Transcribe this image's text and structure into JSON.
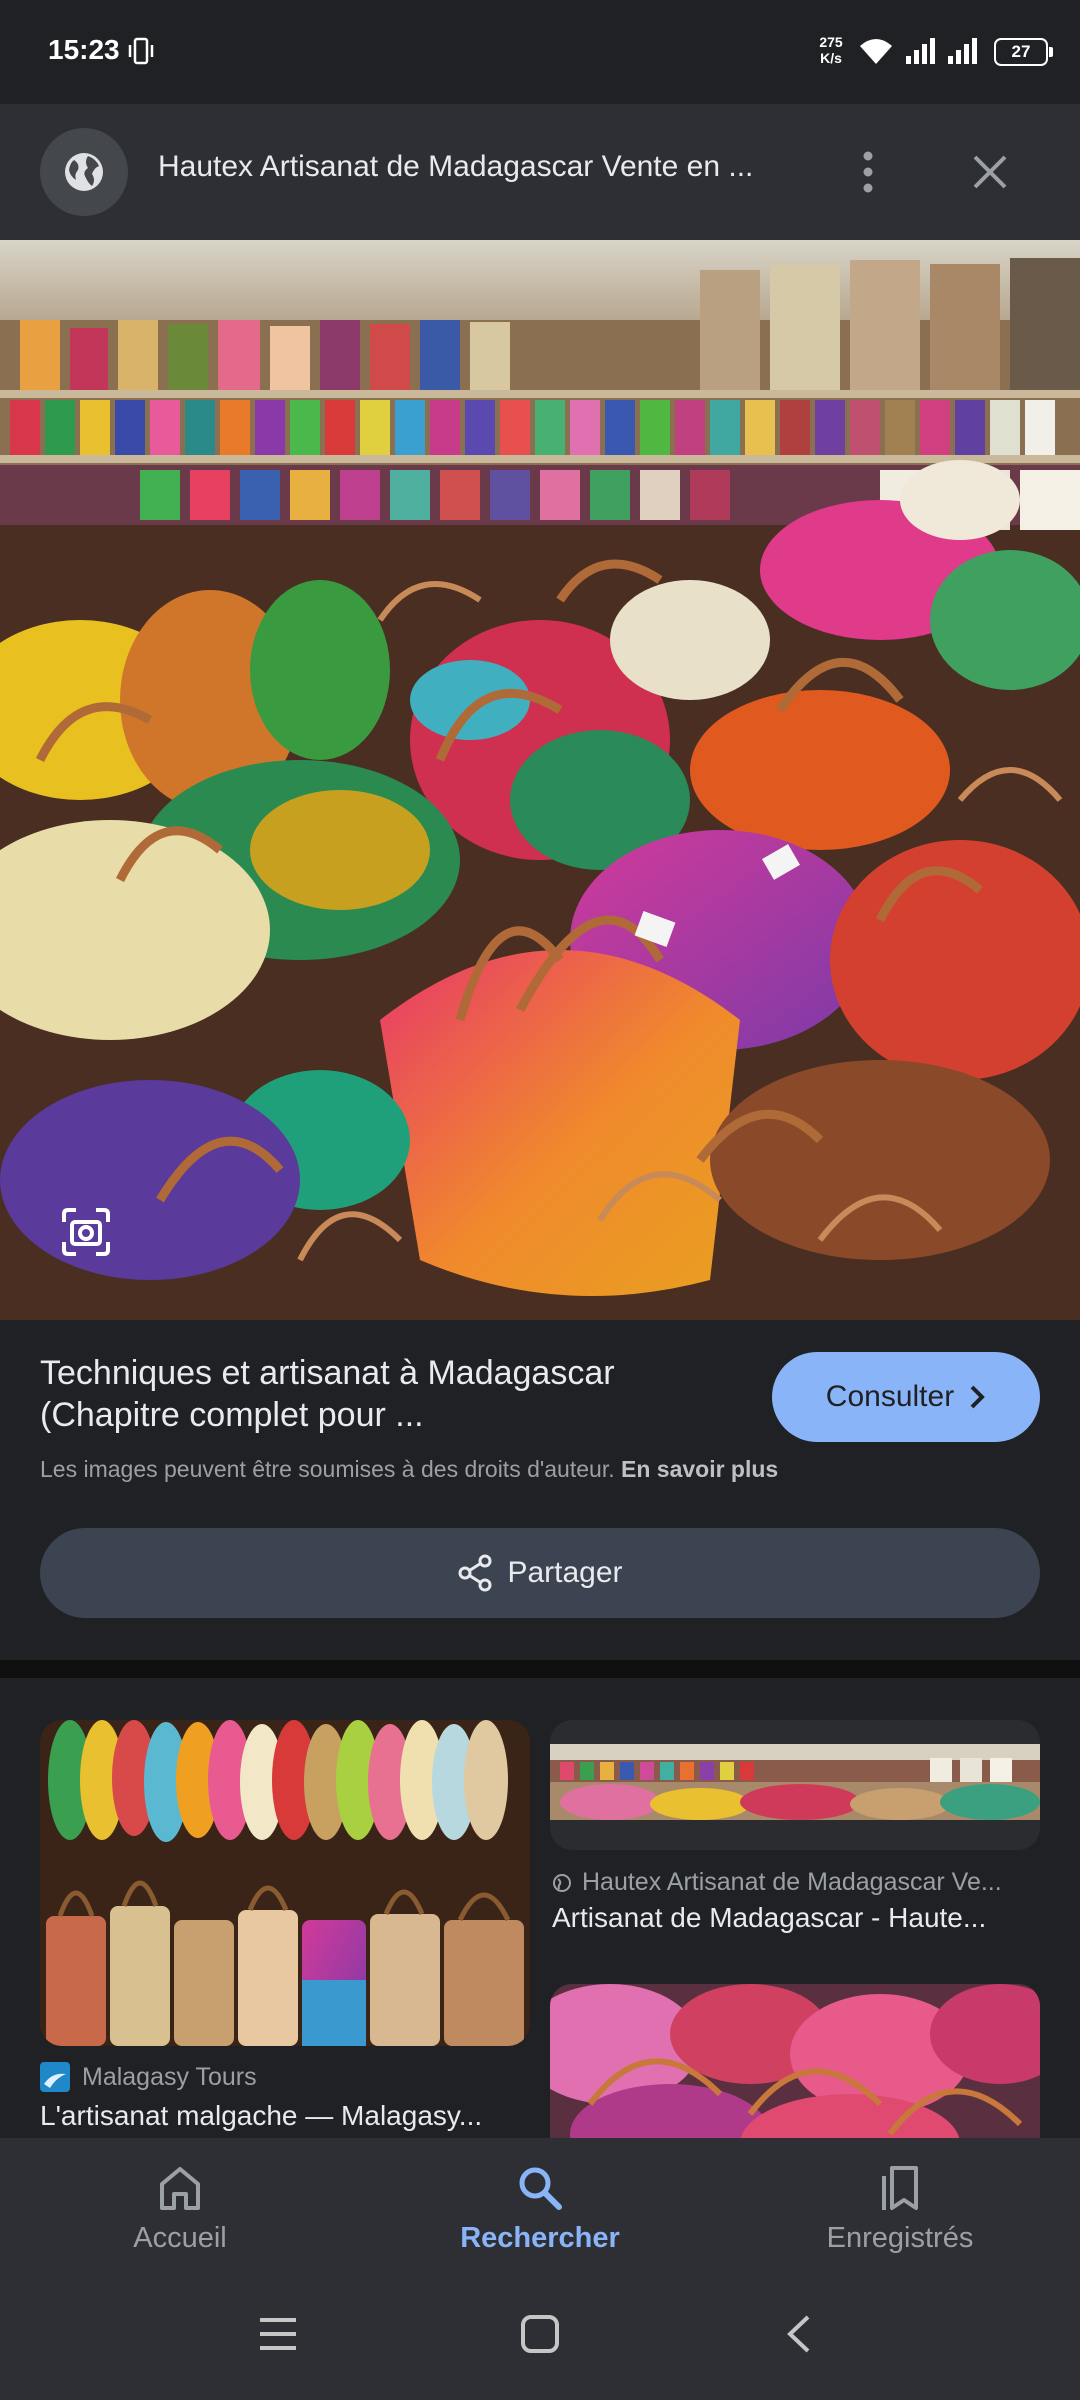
{
  "status_bar": {
    "time": "15:23",
    "net_speed_value": "275",
    "net_speed_unit": "K/s",
    "battery": "27",
    "icons": [
      "vibrate-icon",
      "wifi-icon",
      "signal-icon",
      "signal-icon",
      "battery-icon"
    ]
  },
  "header": {
    "title": "Hautex Artisanat de Madagascar Vente en ...",
    "icons": [
      "globe-icon",
      "more-vert-icon",
      "close-icon"
    ]
  },
  "result": {
    "title": "Techniques et artisanat à Madagascar (Chapitre complet pour ...",
    "consult_label": "Consulter",
    "copyright_text": "Les images peuvent être soumises à des droits d'auteur.",
    "learn_more": "En savoir plus",
    "share_label": "Partager"
  },
  "related": [
    {
      "source": "Malagasy Tours",
      "title": "L'artisanat malgache — Malagasy..."
    },
    {
      "source": "Hautex Artisanat de Madagascar Ve...",
      "title": "Artisanat de Madagascar - Haute..."
    }
  ],
  "bottom_nav": {
    "home_label": "Accueil",
    "search_label": "Rechercher",
    "saved_label": "Enregistrés",
    "active": "search"
  },
  "colors": {
    "accent": "#8ab4f8",
    "background": "#202124",
    "surface": "#2d2f34",
    "share_button": "#3c4452"
  }
}
